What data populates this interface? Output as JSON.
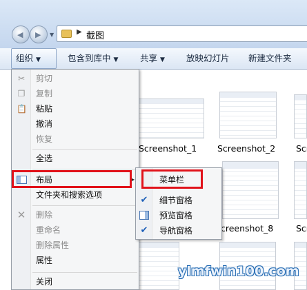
{
  "address": {
    "path": "截图"
  },
  "toolbar": {
    "items": [
      {
        "label": "组织",
        "has_menu": true
      },
      {
        "label": "包含到库中",
        "has_menu": true
      },
      {
        "label": "共享",
        "has_menu": true
      },
      {
        "label": "放映幻灯片",
        "has_menu": false
      },
      {
        "label": "新建文件夹",
        "has_menu": false
      }
    ]
  },
  "organize_menu": {
    "items": [
      {
        "label": "剪切",
        "enabled": false,
        "icon": "scissors-icon"
      },
      {
        "label": "复制",
        "enabled": false,
        "icon": "copy-icon"
      },
      {
        "label": "粘贴",
        "enabled": true,
        "icon": "paste-icon"
      },
      {
        "label": "撤消",
        "enabled": true
      },
      {
        "label": "恢复",
        "enabled": false
      },
      {
        "label": "全选",
        "enabled": true
      },
      {
        "label": "布局",
        "enabled": true,
        "icon": "layout-icon",
        "has_submenu": true
      },
      {
        "label": "文件夹和搜索选项",
        "enabled": true
      },
      {
        "label": "删除",
        "enabled": false,
        "icon": "delete-x-icon"
      },
      {
        "label": "重命名",
        "enabled": false
      },
      {
        "label": "删除属性",
        "enabled": false
      },
      {
        "label": "属性",
        "enabled": true
      },
      {
        "label": "关闭",
        "enabled": true
      }
    ]
  },
  "layout_submenu": {
    "items": [
      {
        "label": "菜单栏",
        "checked": false
      },
      {
        "label": "细节窗格",
        "checked": true
      },
      {
        "label": "预览窗格",
        "checked": false,
        "icon": "preview-pane-icon"
      },
      {
        "label": "导航窗格",
        "checked": true
      }
    ]
  },
  "files": [
    {
      "name": "Screenshot_1"
    },
    {
      "name": "Screenshot_2"
    },
    {
      "name": "Scr"
    },
    {
      "name": "creenshot_8"
    },
    {
      "name": "Scr"
    }
  ],
  "watermark": {
    "text": "ylmfwin100.com"
  },
  "colors": {
    "highlight": "#e1121a",
    "check": "#1d5fb8"
  }
}
